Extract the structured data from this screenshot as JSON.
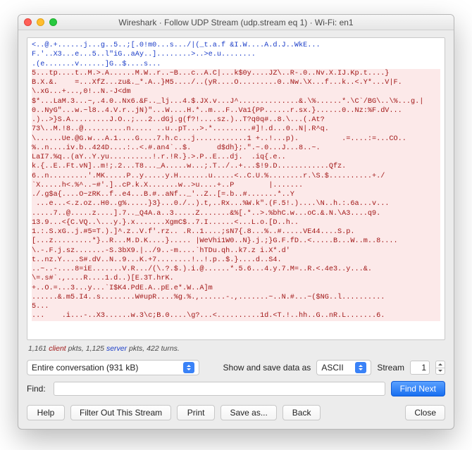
{
  "window": {
    "title": "Wireshark · Follow UDP Stream (udp.stream eq 1) · Wi-Fi: en1"
  },
  "stream": {
    "lines": [
      {
        "cls": "srv",
        "t": "<..@.+......j...g..5..;[.0!m0...s.../|(_t.a.f &I.W....A.d.J..WkE..."
      },
      {
        "cls": "srv",
        "t": "F.'..X3...e...5..l\"iG..aAy..]........>..>e.u........"
      },
      {
        "cls": "srv",
        "t": ".(e.......v......]G..$....s..."
      },
      {
        "cls": "cli",
        "t": "5...tp....t..M.>.A......M.W..r..~B...c..A.C|...k$0y....JZ\\..R-.0..Nv.X.IJ.Kp.t....}"
      },
      {
        "cls": "cli",
        "t": "B.X.&.    =...XfZ...zu&._*.A..}M5..../..(yR....O.........0..Nw.\\X...f...k..<.Y*...V|F."
      },
      {
        "cls": "cli",
        "t": "\\.xG...+...,0!..N.-J<dm"
      },
      {
        "cls": "cli",
        "t": "$*...LaM.3...~,.4.0..Nx6.&F.._lj...4.$.JX.v...J^..............&.\\%......*.\\C`/BG\\..\\%...g.|"
      },
      {
        "cls": "cli",
        "t": "0..NyG\"...w.~l8..4.V.r..jN)\"...W....H.*..m...F..Va1{PP......r.sx.}......0..Nz:%F.dV..."
      },
      {
        "cls": "cli",
        "t": ".)..>}S.A.........J.O..;...2..dGj.g(f?!....sz.)..T?q0q#..8.\\...(.At?"
      },
      {
        "cls": "cli",
        "t": "73\\..M.!8..@..........n..... ..u..pT...>.*.........#]!.d...0..N|.R^q."
      },
      {
        "cls": "cli",
        "t": "\\......Ue.@G.w...A.1....G....7.h.c...j............1 +..!...p).          .=....:=...CO.."
      },
      {
        "cls": "cli",
        "t": "%..n....iv.b..424D....:..<.#.an4`..$.      d$dh};.\".~.0...J...8..~."
      },
      {
        "cls": "cli",
        "t": "LaI7.%q..(aY..Y.yu..........!.r.!R.}.>.P..E...dj.  .iq{.e.."
      },
      {
        "cls": "cli",
        "t": "k.{..E..Ft.vN]..m!;.2...T8..._A.....w...;.T../..+...$!9.D............Qfz."
      },
      {
        "cls": "cli",
        "t": "6..n.........'.MK.....P..y.....y.H.......u.....<..C.U.%........r.\\S.$..........+./"
      },
      {
        "cls": "cli",
        "t": "`X.....h<.%^..~#'.]..cP.k.X.......w..>u....+..P        |......."
      },
      {
        "cls": "cli",
        "t": "./.g$a{....O~zRK..f..e4...B.#..aNf.._'..Z..[=.b..#.......*..Y"
      },
      {
        "cls": "cli",
        "t": " ...e...<.z.oz..H0..g%.....}3}...0./..).t,..Rx...%W.k\".(F.5!.)....\\N..h.:.6a...v..."
      },
      {
        "cls": "cli",
        "t": ".....7..@.....z....].7.._Q4A.a..3.....Z.......&%[.*..>.%bhC.w...oC.&.N.\\A3....q9."
      },
      {
        "cls": "cli",
        "t": "13.9...<{C.VQ..\\...y.}.x.......XgmC$..7.I......<...L.o.[D..h.."
      },
      {
        "cls": "cli",
        "t": "1.:.S.xG..j.#5=T.).]^.z..V.f'.rz.. .R..1....;sN7{.8...%..#.....VE44....S.p."
      },
      {
        "cls": "cli",
        "t": "[...z.........*}..R...M.D.K....}..... |WeVhi1W0..N}.j.;}G.F.fD..<.....B...W..m..8...."
      },
      {
        "cls": "cli",
        "t": "\\.-.F.j.sz.......-S.3bX9.|../9..-m....`hTDu.qh..k7.z i.X*.d'"
      },
      {
        "cls": "cli",
        "t": "t..nz.Y....S#.dV..N..9...K.+7........!..!.p..$.}....d..S4."
      },
      {
        "cls": "cli",
        "t": "..~..-....8=iE.......V.R.../(\\.?.$.).i.@......*.5.6...4.y.7.M=..R.<.4e3..y...&."
      },
      {
        "cls": "cli",
        "t": "\\=.s#`.,....R....1.d..)[E.3T.hrK."
      },
      {
        "cls": "cli",
        "t": "+..O.=...3...y...`I$K4.PdE.A..pE.e*.W..A]m"
      },
      {
        "cls": "cli",
        "t": "......&.m5.I4..s........W#upR....%g.%.,......-.,.......~..N.#...~($NG..l.........."
      },
      {
        "cls": "cli",
        "t": "5..."
      },
      {
        "cls": "cli",
        "t": "...    .i...-..X3......w.3\\c;B.0....\\g?...<..........1d.<T.!..hh..G..nR.L.......6."
      }
    ]
  },
  "stats": {
    "client_pkts": "1,161",
    "client_word": "client",
    "mid": " pkts, ",
    "server_pkts": "1,125",
    "server_word": "server",
    "tail": " pkts, 422 turns."
  },
  "controls": {
    "conversation_select": "Entire conversation (931 kB)",
    "show_as_label": "Show and save data as",
    "show_as_value": "ASCII",
    "stream_label": "Stream",
    "stream_value": "1",
    "find_label": "Find:",
    "find_value": "",
    "find_next": "Find Next",
    "help": "Help",
    "filter_out": "Filter Out This Stream",
    "print": "Print",
    "save_as": "Save as...",
    "back": "Back",
    "close": "Close"
  }
}
